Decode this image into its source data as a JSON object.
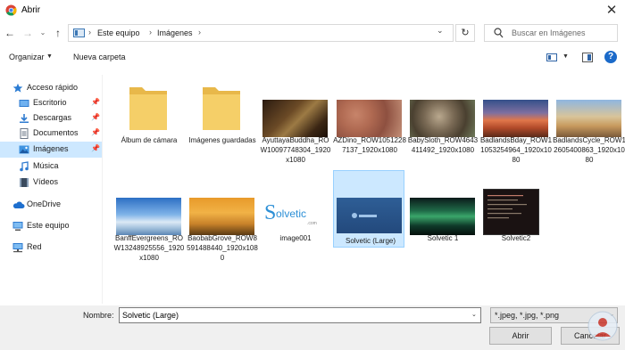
{
  "window": {
    "title": "Abrir"
  },
  "address": {
    "crumbs": [
      "Este equipo",
      "Imágenes"
    ],
    "search_placeholder": "Buscar en Imágenes"
  },
  "toolbar": {
    "organize_label": "Organizar",
    "new_folder_label": "Nueva carpeta"
  },
  "sidebar": {
    "items": [
      {
        "label": "Acceso rápido",
        "icon": "star-icon"
      },
      {
        "label": "Escritorio",
        "icon": "desktop-icon"
      },
      {
        "label": "Descargas",
        "icon": "download-icon"
      },
      {
        "label": "Documentos",
        "icon": "documents-icon"
      },
      {
        "label": "Imágenes",
        "icon": "pictures-icon"
      },
      {
        "label": "Música",
        "icon": "music-icon"
      },
      {
        "label": "Vídeos",
        "icon": "videos-icon"
      },
      {
        "label": "OneDrive",
        "icon": "cloud-icon"
      },
      {
        "label": "Este equipo",
        "icon": "computer-icon"
      },
      {
        "label": "Red",
        "icon": "network-icon"
      }
    ]
  },
  "files": [
    {
      "name": "Álbum de cámara",
      "kind": "folder"
    },
    {
      "name": "Imágenes guardadas",
      "kind": "folder"
    },
    {
      "name": "AyuttayaBuddha_ROW10097748304_1920x1080",
      "kind": "image"
    },
    {
      "name": "AZDino_ROW10512287137_1920x1080",
      "kind": "image"
    },
    {
      "name": "BabySloth_ROW4643411492_1920x1080",
      "kind": "image"
    },
    {
      "name": "BadlandsBday_ROW11053254964_1920x1080",
      "kind": "image"
    },
    {
      "name": "BadlandsCycle_ROW12605400863_1920x1080",
      "kind": "image"
    },
    {
      "name": "BanffEvergreens_ROW13248925556_1920x1080",
      "kind": "image"
    },
    {
      "name": "BaobabGrove_ROW8591488440_1920x1080",
      "kind": "image"
    },
    {
      "name": "image001",
      "kind": "image",
      "logo_text": "olvetic"
    },
    {
      "name": "Solvetic (Large)",
      "kind": "image",
      "selected": true
    },
    {
      "name": "Solvetic 1",
      "kind": "image"
    },
    {
      "name": "Solvetic2",
      "kind": "image"
    }
  ],
  "footer": {
    "name_label": "Nombre:",
    "name_value": "Solvetic (Large)",
    "filter_value": "*.jpeg, *.jpg, *.png",
    "open_label": "Abrir",
    "cancel_label": "Cancelar"
  },
  "colors": {
    "selected_bg": "#cce8ff",
    "selected_border": "#99d1ff",
    "nav_selected_bg": "#cde8ff",
    "accent": "#1b6ac9"
  }
}
